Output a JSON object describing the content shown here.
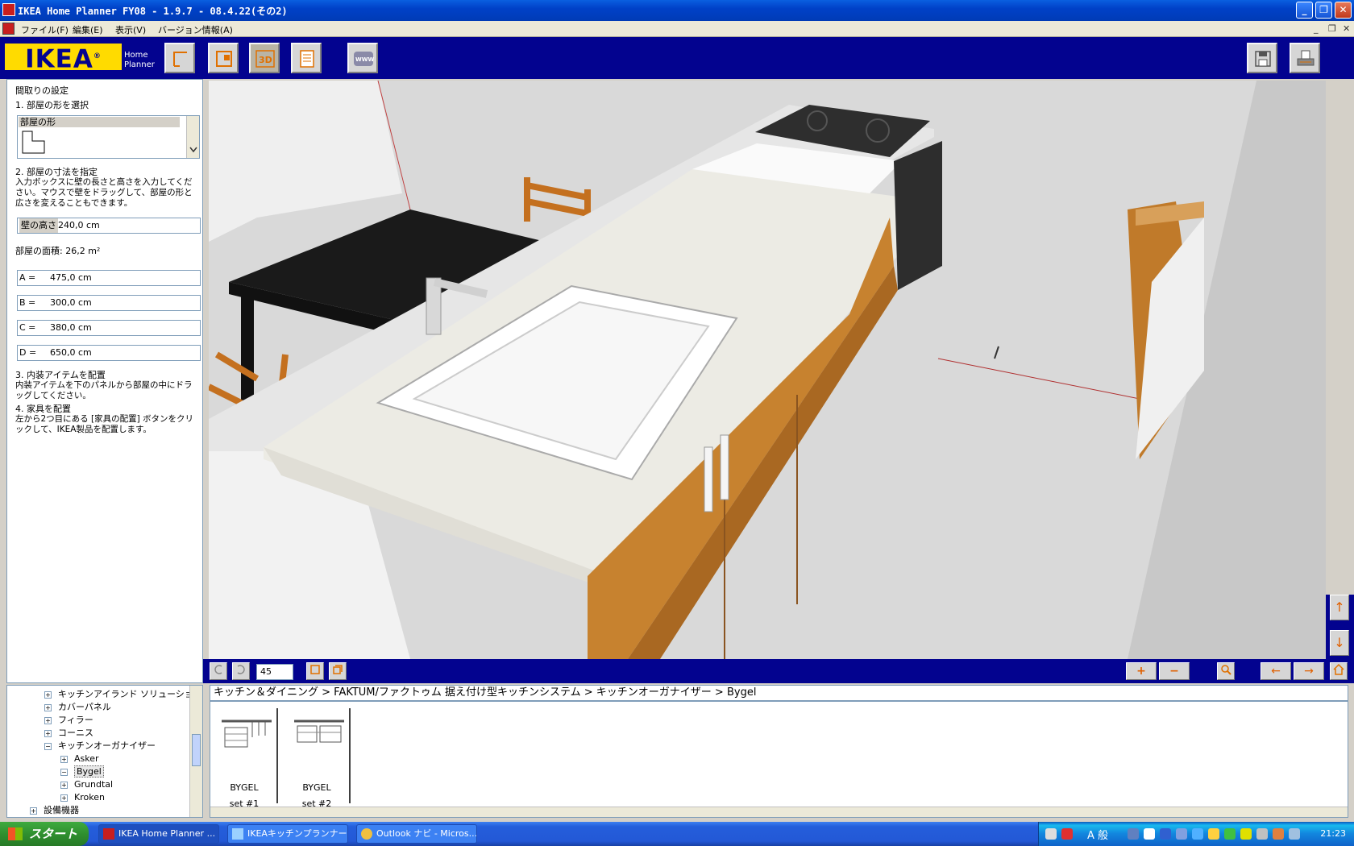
{
  "window": {
    "title": "IKEA Home Planner FY08  - 1.9.7 - 08.4.22(その2)",
    "minimize": "_",
    "maximize": "❐",
    "close": "✕"
  },
  "menu": {
    "items": [
      "ファイル(F)",
      "編集(E)",
      "表示(V)",
      "バージョン情報(A)"
    ],
    "mdi_min": "_",
    "mdi_restore": "❐",
    "mdi_close": "✕"
  },
  "toolbar": {
    "logo": "IKEA",
    "logo_mark": "®",
    "logo_sub_line1": "Home",
    "logo_sub_line2": "Planner",
    "www_label": "WWW",
    "view3d_label": "3D"
  },
  "left_panel": {
    "heading": "間取りの設定",
    "step1": "1. 部屋の形を選択",
    "shape_list_header": "部屋の形",
    "step2_title": "2. 部屋の寸法を指定",
    "step2_desc": "入力ボックスに壁の長さと高さを入力してください。マウスで壁をドラッグして、部屋の形と広さを変えることもできます。",
    "wall_height_label": "壁の高さ",
    "wall_height_value": "240,0 cm",
    "area_text": "部屋の面積: 26,2 m²",
    "dimensions": [
      {
        "label": "A =",
        "value": "475,0 cm"
      },
      {
        "label": "B =",
        "value": "300,0 cm"
      },
      {
        "label": "C =",
        "value": "380,0 cm"
      },
      {
        "label": "D =",
        "value": "650,0 cm"
      }
    ],
    "step3_title": "3. 内装アイテムを配置",
    "step3_desc": "内装アイテムを下のパネルから部屋の中にドラッグしてください。",
    "step4_title": "4. 家具を配置",
    "step4_desc": "左から2つ目にある [家具の配置] ボタンをクリックして、IKEA製品を配置します。"
  },
  "viewport_toolbar": {
    "zoom_value": "45",
    "plus": "+",
    "minus": "−",
    "arrow_left": "←",
    "arrow_right": "→",
    "arrow_up": "↑",
    "arrow_down": "↓"
  },
  "tree": {
    "items": [
      {
        "label": "キッチンアイランド ソリューション",
        "toggle": "+",
        "level": 2
      },
      {
        "label": "カバーパネル",
        "toggle": "+",
        "level": 2
      },
      {
        "label": "フィラー",
        "toggle": "+",
        "level": 2
      },
      {
        "label": "コーニス",
        "toggle": "+",
        "level": 2
      },
      {
        "label": "キッチンオーガナイザー",
        "toggle": "−",
        "level": 2
      },
      {
        "label": "Asker",
        "toggle": "+",
        "level": 3
      },
      {
        "label": "Bygel",
        "toggle": "−",
        "level": 3,
        "selected": true
      },
      {
        "label": "Grundtal",
        "toggle": "+",
        "level": 3
      },
      {
        "label": "Kroken",
        "toggle": "+",
        "level": 3
      },
      {
        "label": "設備機器",
        "toggle": "+",
        "level": 1
      }
    ]
  },
  "breadcrumb": "キッチン＆ダイニング > FAKTUM/ファクトゥム 据え付け型キッチンシステム > キッチンオーガナイザー > Bygel",
  "products": [
    {
      "name": "BYGEL",
      "set": "set #1"
    },
    {
      "name": "BYGEL",
      "set": "set #2"
    }
  ],
  "taskbar": {
    "start": "スタート",
    "tasks": [
      {
        "label": "IKEA Home Planner ..."
      },
      {
        "label": "IKEAキッチンプランナー - ..."
      },
      {
        "label": "Outlook ナビ - Micros..."
      }
    ],
    "ime": "A 般",
    "clock": "21:23"
  },
  "colors": {
    "ikea_blue": "#03038f",
    "ikea_yellow": "#ffdb00",
    "xp_blue": "#245edb",
    "start_green": "#2f8f2f"
  }
}
